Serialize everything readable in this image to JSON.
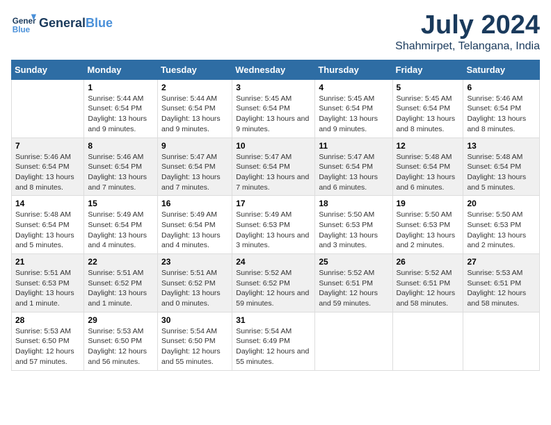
{
  "header": {
    "logo_line1": "General",
    "logo_line2": "Blue",
    "month": "July 2024",
    "location": "Shahmirpet, Telangana, India"
  },
  "days_of_week": [
    "Sunday",
    "Monday",
    "Tuesday",
    "Wednesday",
    "Thursday",
    "Friday",
    "Saturday"
  ],
  "weeks": [
    [
      {
        "date": "",
        "sunrise": "",
        "sunset": "",
        "daylight": ""
      },
      {
        "date": "1",
        "sunrise": "Sunrise: 5:44 AM",
        "sunset": "Sunset: 6:54 PM",
        "daylight": "Daylight: 13 hours and 9 minutes."
      },
      {
        "date": "2",
        "sunrise": "Sunrise: 5:44 AM",
        "sunset": "Sunset: 6:54 PM",
        "daylight": "Daylight: 13 hours and 9 minutes."
      },
      {
        "date": "3",
        "sunrise": "Sunrise: 5:45 AM",
        "sunset": "Sunset: 6:54 PM",
        "daylight": "Daylight: 13 hours and 9 minutes."
      },
      {
        "date": "4",
        "sunrise": "Sunrise: 5:45 AM",
        "sunset": "Sunset: 6:54 PM",
        "daylight": "Daylight: 13 hours and 9 minutes."
      },
      {
        "date": "5",
        "sunrise": "Sunrise: 5:45 AM",
        "sunset": "Sunset: 6:54 PM",
        "daylight": "Daylight: 13 hours and 8 minutes."
      },
      {
        "date": "6",
        "sunrise": "Sunrise: 5:46 AM",
        "sunset": "Sunset: 6:54 PM",
        "daylight": "Daylight: 13 hours and 8 minutes."
      }
    ],
    [
      {
        "date": "7",
        "sunrise": "Sunrise: 5:46 AM",
        "sunset": "Sunset: 6:54 PM",
        "daylight": "Daylight: 13 hours and 8 minutes."
      },
      {
        "date": "8",
        "sunrise": "Sunrise: 5:46 AM",
        "sunset": "Sunset: 6:54 PM",
        "daylight": "Daylight: 13 hours and 7 minutes."
      },
      {
        "date": "9",
        "sunrise": "Sunrise: 5:47 AM",
        "sunset": "Sunset: 6:54 PM",
        "daylight": "Daylight: 13 hours and 7 minutes."
      },
      {
        "date": "10",
        "sunrise": "Sunrise: 5:47 AM",
        "sunset": "Sunset: 6:54 PM",
        "daylight": "Daylight: 13 hours and 7 minutes."
      },
      {
        "date": "11",
        "sunrise": "Sunrise: 5:47 AM",
        "sunset": "Sunset: 6:54 PM",
        "daylight": "Daylight: 13 hours and 6 minutes."
      },
      {
        "date": "12",
        "sunrise": "Sunrise: 5:48 AM",
        "sunset": "Sunset: 6:54 PM",
        "daylight": "Daylight: 13 hours and 6 minutes."
      },
      {
        "date": "13",
        "sunrise": "Sunrise: 5:48 AM",
        "sunset": "Sunset: 6:54 PM",
        "daylight": "Daylight: 13 hours and 5 minutes."
      }
    ],
    [
      {
        "date": "14",
        "sunrise": "Sunrise: 5:48 AM",
        "sunset": "Sunset: 6:54 PM",
        "daylight": "Daylight: 13 hours and 5 minutes."
      },
      {
        "date": "15",
        "sunrise": "Sunrise: 5:49 AM",
        "sunset": "Sunset: 6:54 PM",
        "daylight": "Daylight: 13 hours and 4 minutes."
      },
      {
        "date": "16",
        "sunrise": "Sunrise: 5:49 AM",
        "sunset": "Sunset: 6:54 PM",
        "daylight": "Daylight: 13 hours and 4 minutes."
      },
      {
        "date": "17",
        "sunrise": "Sunrise: 5:49 AM",
        "sunset": "Sunset: 6:53 PM",
        "daylight": "Daylight: 13 hours and 3 minutes."
      },
      {
        "date": "18",
        "sunrise": "Sunrise: 5:50 AM",
        "sunset": "Sunset: 6:53 PM",
        "daylight": "Daylight: 13 hours and 3 minutes."
      },
      {
        "date": "19",
        "sunrise": "Sunrise: 5:50 AM",
        "sunset": "Sunset: 6:53 PM",
        "daylight": "Daylight: 13 hours and 2 minutes."
      },
      {
        "date": "20",
        "sunrise": "Sunrise: 5:50 AM",
        "sunset": "Sunset: 6:53 PM",
        "daylight": "Daylight: 13 hours and 2 minutes."
      }
    ],
    [
      {
        "date": "21",
        "sunrise": "Sunrise: 5:51 AM",
        "sunset": "Sunset: 6:53 PM",
        "daylight": "Daylight: 13 hours and 1 minute."
      },
      {
        "date": "22",
        "sunrise": "Sunrise: 5:51 AM",
        "sunset": "Sunset: 6:52 PM",
        "daylight": "Daylight: 13 hours and 1 minute."
      },
      {
        "date": "23",
        "sunrise": "Sunrise: 5:51 AM",
        "sunset": "Sunset: 6:52 PM",
        "daylight": "Daylight: 13 hours and 0 minutes."
      },
      {
        "date": "24",
        "sunrise": "Sunrise: 5:52 AM",
        "sunset": "Sunset: 6:52 PM",
        "daylight": "Daylight: 12 hours and 59 minutes."
      },
      {
        "date": "25",
        "sunrise": "Sunrise: 5:52 AM",
        "sunset": "Sunset: 6:51 PM",
        "daylight": "Daylight: 12 hours and 59 minutes."
      },
      {
        "date": "26",
        "sunrise": "Sunrise: 5:52 AM",
        "sunset": "Sunset: 6:51 PM",
        "daylight": "Daylight: 12 hours and 58 minutes."
      },
      {
        "date": "27",
        "sunrise": "Sunrise: 5:53 AM",
        "sunset": "Sunset: 6:51 PM",
        "daylight": "Daylight: 12 hours and 58 minutes."
      }
    ],
    [
      {
        "date": "28",
        "sunrise": "Sunrise: 5:53 AM",
        "sunset": "Sunset: 6:50 PM",
        "daylight": "Daylight: 12 hours and 57 minutes."
      },
      {
        "date": "29",
        "sunrise": "Sunrise: 5:53 AM",
        "sunset": "Sunset: 6:50 PM",
        "daylight": "Daylight: 12 hours and 56 minutes."
      },
      {
        "date": "30",
        "sunrise": "Sunrise: 5:54 AM",
        "sunset": "Sunset: 6:50 PM",
        "daylight": "Daylight: 12 hours and 55 minutes."
      },
      {
        "date": "31",
        "sunrise": "Sunrise: 5:54 AM",
        "sunset": "Sunset: 6:49 PM",
        "daylight": "Daylight: 12 hours and 55 minutes."
      },
      {
        "date": "",
        "sunrise": "",
        "sunset": "",
        "daylight": ""
      },
      {
        "date": "",
        "sunrise": "",
        "sunset": "",
        "daylight": ""
      },
      {
        "date": "",
        "sunrise": "",
        "sunset": "",
        "daylight": ""
      }
    ]
  ]
}
